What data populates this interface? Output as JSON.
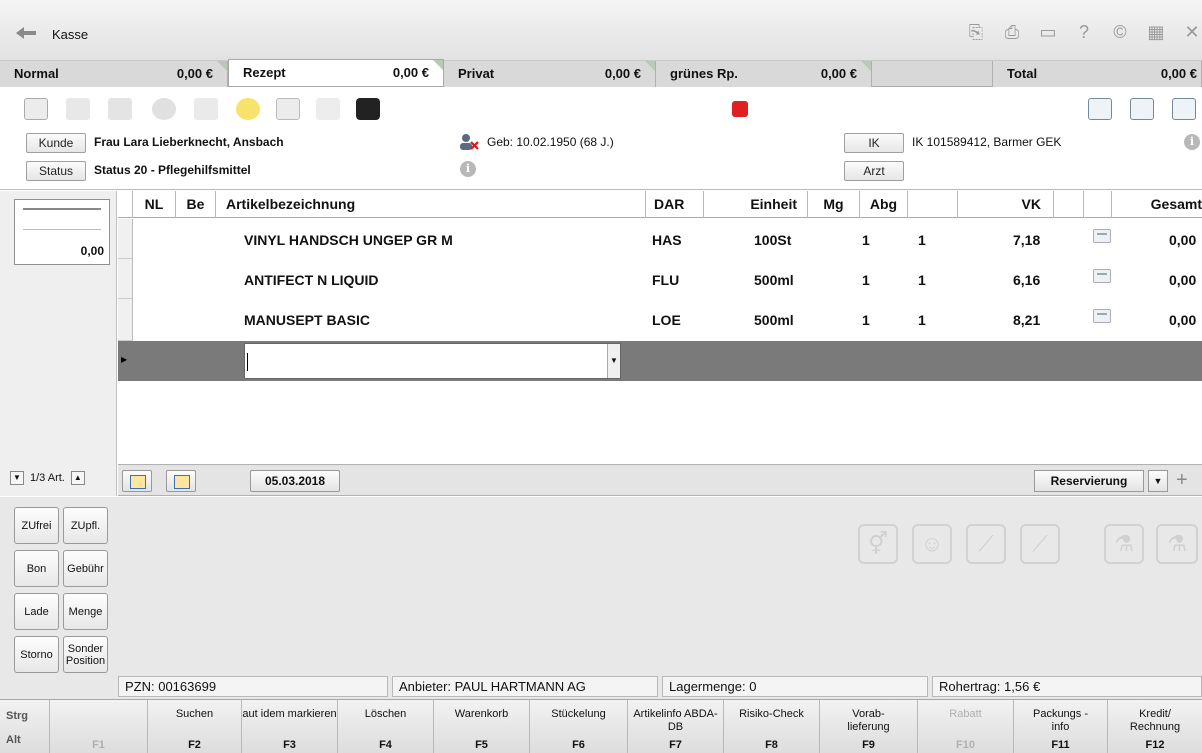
{
  "window": {
    "title": "Kasse",
    "icons": [
      "clipboard-icon",
      "printer-icon",
      "monitor-icon",
      "help-icon",
      "copyright-icon",
      "calculator-icon",
      "close-icon"
    ]
  },
  "tabs": [
    {
      "label": "Normal",
      "amount": "0,00 €"
    },
    {
      "label": "Rezept",
      "amount": "0,00 €"
    },
    {
      "label": "Privat",
      "amount": "0,00 €"
    },
    {
      "label": "grünes Rp.",
      "amount": "0,00 €"
    },
    {
      "label": "Total",
      "amount": "0,00 €"
    }
  ],
  "customer": {
    "kunde_label": "Kunde",
    "name": "Frau Lara Lieberknecht, Ansbach",
    "status_label": "Status",
    "status": "Status 20 - Pflegehilfsmittel",
    "birth": "Geb: 10.02.1950 (68 J.)",
    "ik_label": "IK",
    "ik": "IK 101589412, Barmer GEK",
    "arzt_label": "Arzt"
  },
  "thumb_amount": "0,00",
  "pager": {
    "text": "1/3 Art."
  },
  "grid": {
    "headers": {
      "nl": "NL",
      "be": "Be",
      "name": "Artikelbezeichnung",
      "dar": "DAR",
      "einheit": "Einheit",
      "mg": "Mg",
      "abg": "Abg",
      "vk": "VK",
      "gesamt": "Gesamt"
    },
    "rows": [
      {
        "name": "VINYL HANDSCH UNGEP GR M",
        "dar": "HAS",
        "einheit": "100St",
        "mg": "1",
        "abg": "1",
        "vk": "7,18",
        "gesamt": "0,00"
      },
      {
        "name": "ANTIFECT N LIQUID",
        "dar": "FLU",
        "einheit": "500ml",
        "mg": "1",
        "abg": "1",
        "vk": "6,16",
        "gesamt": "0,00"
      },
      {
        "name": "MANUSEPT BASIC",
        "dar": "LOE",
        "einheit": "500ml",
        "mg": "1",
        "abg": "1",
        "vk": "8,21",
        "gesamt": "0,00"
      }
    ]
  },
  "footer": {
    "date": "05.03.2018",
    "reservierung": "Reservierung"
  },
  "side_buttons": [
    {
      "label": "ZUfrei"
    },
    {
      "label": "ZUpfl."
    },
    {
      "label": "Bon"
    },
    {
      "label": "Gebühr"
    },
    {
      "label": "Lade"
    },
    {
      "label": "Menge"
    },
    {
      "label": "Storno"
    },
    {
      "label": "Sonder Position"
    }
  ],
  "status": {
    "pzn": "PZN: 00163699",
    "anbieter": "Anbieter: PAUL HARTMANN AG",
    "lager": "Lagermenge: 0",
    "rohertrag": "Rohertrag: 1,56 €"
  },
  "fkeys": {
    "strg": "Strg",
    "alt": "Alt",
    "keys": [
      {
        "label": "",
        "key": "F1",
        "enabled": false
      },
      {
        "label": "Suchen",
        "key": "F2",
        "enabled": true
      },
      {
        "label": "aut idem markieren",
        "key": "F3",
        "enabled": true
      },
      {
        "label": "Löschen",
        "key": "F4",
        "enabled": true
      },
      {
        "label": "Warenkorb",
        "key": "F5",
        "enabled": true
      },
      {
        "label": "Stückelung",
        "key": "F6",
        "enabled": true
      },
      {
        "label": "Artikelinfo ABDA-DB",
        "key": "F7",
        "enabled": true
      },
      {
        "label": "Risiko-Check",
        "key": "F8",
        "enabled": true
      },
      {
        "label": "Vorab-lieferung",
        "key": "F9",
        "enabled": true
      },
      {
        "label": "Rabatt",
        "key": "F10",
        "enabled": false
      },
      {
        "label": "Packungs - info",
        "key": "F11",
        "enabled": true
      },
      {
        "label": "Kredit/ Rechnung",
        "key": "F12",
        "enabled": true
      }
    ]
  },
  "colors": {
    "accent_red": "#e02020",
    "edit_row": "#7a7a7a"
  }
}
